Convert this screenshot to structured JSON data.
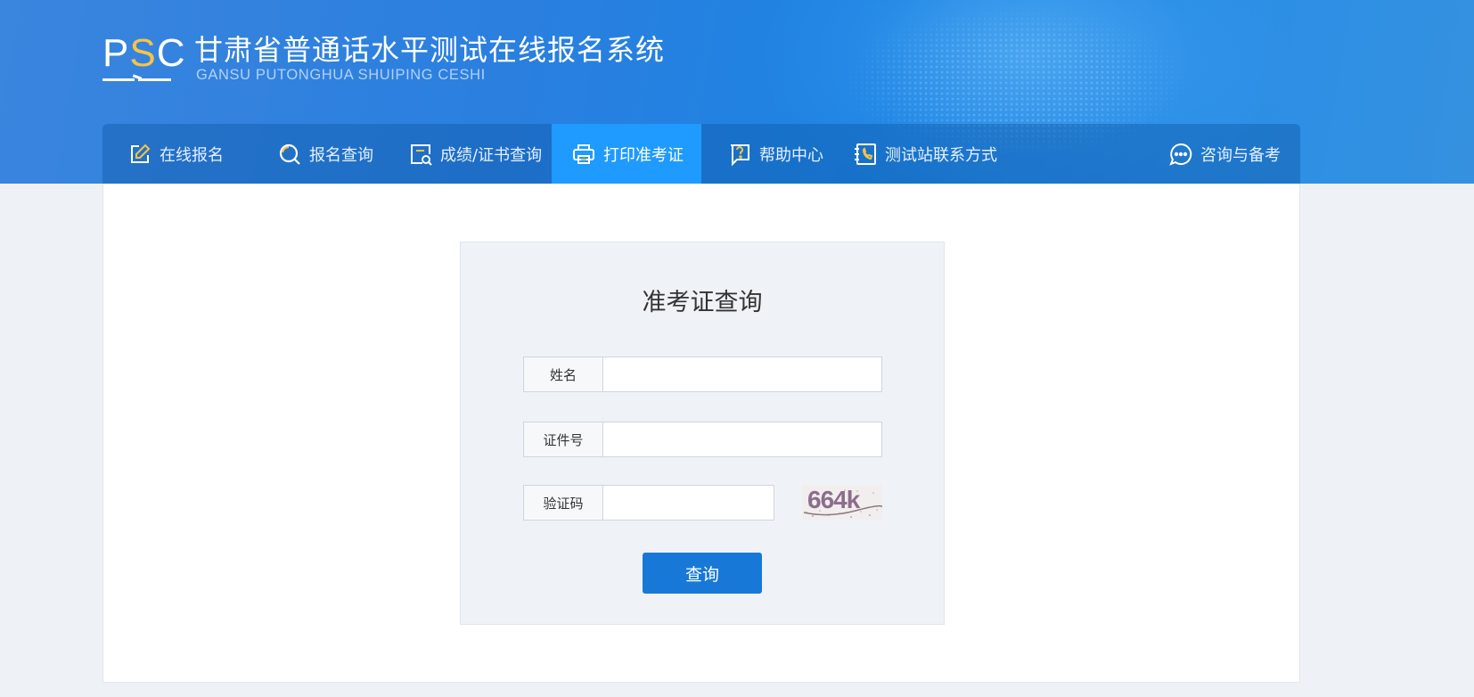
{
  "header": {
    "logo": {
      "letters": [
        "P",
        "S",
        "C"
      ],
      "accent_letter_color": "#f6c445"
    },
    "title": "甘肃省普通话水平测试在线报名系统",
    "subtitle": "GANSU PUTONGHUA SHUIPING CESHI"
  },
  "nav": {
    "items": [
      {
        "label": "在线报名",
        "icon": "edit-icon"
      },
      {
        "label": "报名查询",
        "icon": "search-icon"
      },
      {
        "label": "成绩/证书查询",
        "icon": "document-search-icon"
      },
      {
        "label": "打印准考证",
        "icon": "printer-icon",
        "active": true
      },
      {
        "label": "帮助中心",
        "icon": "help-icon"
      },
      {
        "label": "测试站联系方式",
        "icon": "contact-phone-icon"
      }
    ],
    "right_item": {
      "label": "咨询与备考",
      "icon": "chat-icon"
    },
    "active_color": "#1f9aff"
  },
  "form": {
    "title": "准考证查询",
    "fields": {
      "name": {
        "label": "姓名",
        "value": ""
      },
      "id_number": {
        "label": "证件号",
        "value": ""
      },
      "captcha": {
        "label": "验证码",
        "value": "",
        "image_text": "664k"
      }
    },
    "submit_label": "查询",
    "button_color": "#1878d8"
  }
}
